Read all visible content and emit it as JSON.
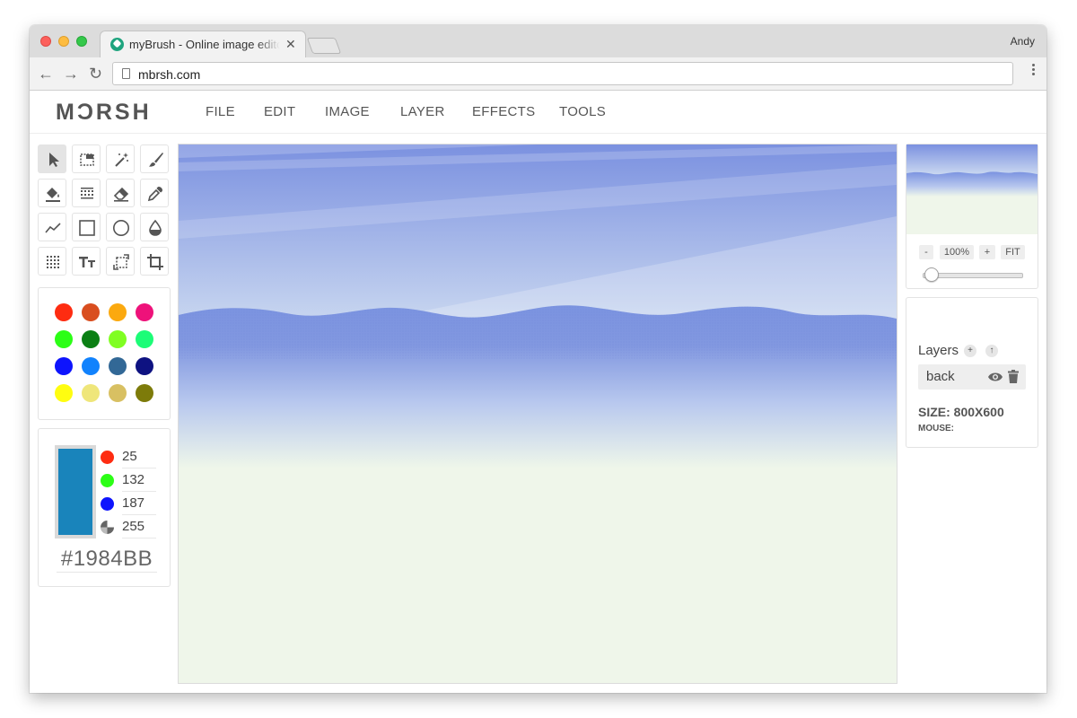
{
  "browser": {
    "tab_title": "myBrush - Online image editor",
    "tab_close": "✕",
    "profile_name": "Andy",
    "url": "mbrsh.com",
    "back_glyph": "←",
    "forward_glyph": "→",
    "reload_glyph": "↻"
  },
  "app": {
    "logo": "MƆRSH",
    "menu": [
      "FILE",
      "EDIT",
      "IMAGE",
      "LAYER",
      "EFFECTS",
      "TOOLS"
    ]
  },
  "tools": [
    "select-arrow-icon",
    "rect-select-icon",
    "magic-wand-icon",
    "brush-icon",
    "paint-bucket-icon",
    "pattern-icon",
    "eraser-icon",
    "eyedropper-icon",
    "line-icon",
    "rectangle-icon",
    "circle-icon",
    "drop-icon",
    "grid-icon",
    "text-icon",
    "crop-selection-icon",
    "crop-icon"
  ],
  "palette": [
    "#fe2c11",
    "#d94e1f",
    "#fba90f",
    "#ee127a",
    "#2cfe16",
    "#0b7f14",
    "#80fe22",
    "#1cfc77",
    "#0e14fd",
    "#1182fd",
    "#326896",
    "#0e1281",
    "#fffd10",
    "#efe67a",
    "#d8c062",
    "#7d7b0a"
  ],
  "color": {
    "swatch": "#1984BB",
    "r": "25",
    "g": "132",
    "b": "187",
    "a": "255",
    "hex": "#1984BB"
  },
  "zoom": {
    "minus": "-",
    "value": "100%",
    "plus": "+",
    "fit": "FIT",
    "slider_percent": 10
  },
  "layers": {
    "title": "Layers",
    "add": "+",
    "up": "↑",
    "items": [
      "back"
    ],
    "size_label": "SIZE: 800X600",
    "mouse_label": "MOUSE:"
  }
}
